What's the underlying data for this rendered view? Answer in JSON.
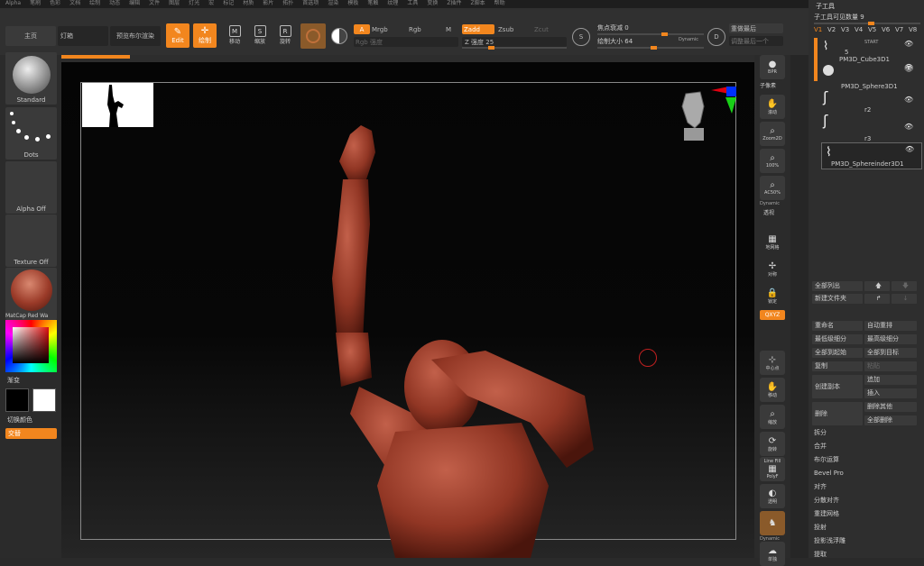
{
  "menu": [
    "Alpha",
    "笔刷",
    "色彩",
    "文档",
    "绘制",
    "动态",
    "编辑",
    "文件",
    "图层",
    "灯光",
    "宏",
    "标记",
    "材质",
    "影片",
    "拓扑",
    "首选项",
    "渲染",
    "模板",
    "笔触",
    "纹理",
    "工具",
    "变换",
    "Z插件",
    "Z脚本",
    "帮助"
  ],
  "top": {
    "home_label": "主页",
    "lights_label": "灯箱",
    "preview_label": "预览布尔渲染",
    "edit_label": "Edit",
    "draw_label": "绘制",
    "move_label": "移动",
    "scale_label": "缩放",
    "rotate_label": "旋转",
    "a_label": "A",
    "mrgb_label": "Mrgb",
    "rgb_label": "Rgb",
    "m_label": "M",
    "rgb_intensity_label": "Rgb 强度",
    "zadd_label": "Zadd",
    "zsub_label": "Zsub",
    "zcut_label": "Zcut",
    "z_intensity_label": "Z 强度",
    "z_intensity_value": "25",
    "focal_label": "焦点衰减",
    "focal_value": "0",
    "draw_size_label": "绘制大小",
    "draw_size_value": "64",
    "dynamic_label": "Dynamic",
    "s_label": "S",
    "d_label": "D",
    "replay_label": "重做最后",
    "relative_label": "调整最后一个",
    "z_intensity_fraction": 0.25,
    "draw_size_fraction": 0.5,
    "focal_fraction": 0.6
  },
  "left": {
    "brush_label": "Standard",
    "stroke_label": "Dots",
    "alpha_label": "Alpha Off",
    "texture_label": "Texture Off",
    "material_label": "MatCap Red Wa",
    "gradient_label": "渐变",
    "switch_color_label": "切换颜色",
    "alternate_label": "交替"
  },
  "right_tools": {
    "bpr": "BPR",
    "subtool_label": "子像素",
    "scroll": "滚动",
    "zoom2d": "Zoom2D",
    "p100": "100%",
    "ac50": "AC50%",
    "dynamic": "Dynamic",
    "persp": "透视",
    "floor": "地网格",
    "local": "对称",
    "lock": "锁定",
    "xyz": "QXYZ",
    "center": "中心点",
    "move": "移动",
    "scale": "缩放",
    "rotate": "旋转",
    "linefill": "Line Fill",
    "polyf": "PolyF",
    "transp": "透明",
    "dyn2": "Dynamic",
    "solo": "单独"
  },
  "panel": {
    "title": "子工具",
    "visible_count_label": "子工具可见数量",
    "visible_count": "9",
    "tabs": [
      "V1",
      "V2",
      "V3",
      "V4",
      "V5",
      "V6",
      "V7",
      "V8"
    ],
    "start_label": "START",
    "subtools": [
      {
        "name": "5"
      },
      {
        "name": "PM3D_Cube3D1"
      },
      {
        "name": "PM3D_Sphere3D1"
      },
      {
        "name": "r2"
      },
      {
        "name": "r3"
      },
      {
        "name": "PM3D_Sphereinder3D1"
      }
    ],
    "list_all": "全部列出",
    "new_folder": "新建文件夹",
    "rename": "重命名",
    "auto_reorder": "自动重排",
    "lowest_sub": "最低级细分",
    "highest_sub": "最高级细分",
    "all_to_top": "全部到起始",
    "all_to_target": "全部到目标",
    "duplicate": "复制",
    "paste": "粘贴",
    "create_copy": "创建副本",
    "append": "追加",
    "insert": "插入",
    "delete": "删除",
    "del_other": "删除其他",
    "del_all": "全部删除",
    "items": [
      "拆分",
      "合并",
      "布尔运算",
      "Bevel Pro",
      "对齐",
      "分散对齐",
      "重建网格",
      "投射",
      "投影浅浮雕",
      "提取"
    ]
  },
  "colors": {
    "accent": "#f2861e",
    "clay": "#a9442e",
    "bg": "#2a2a2a"
  }
}
